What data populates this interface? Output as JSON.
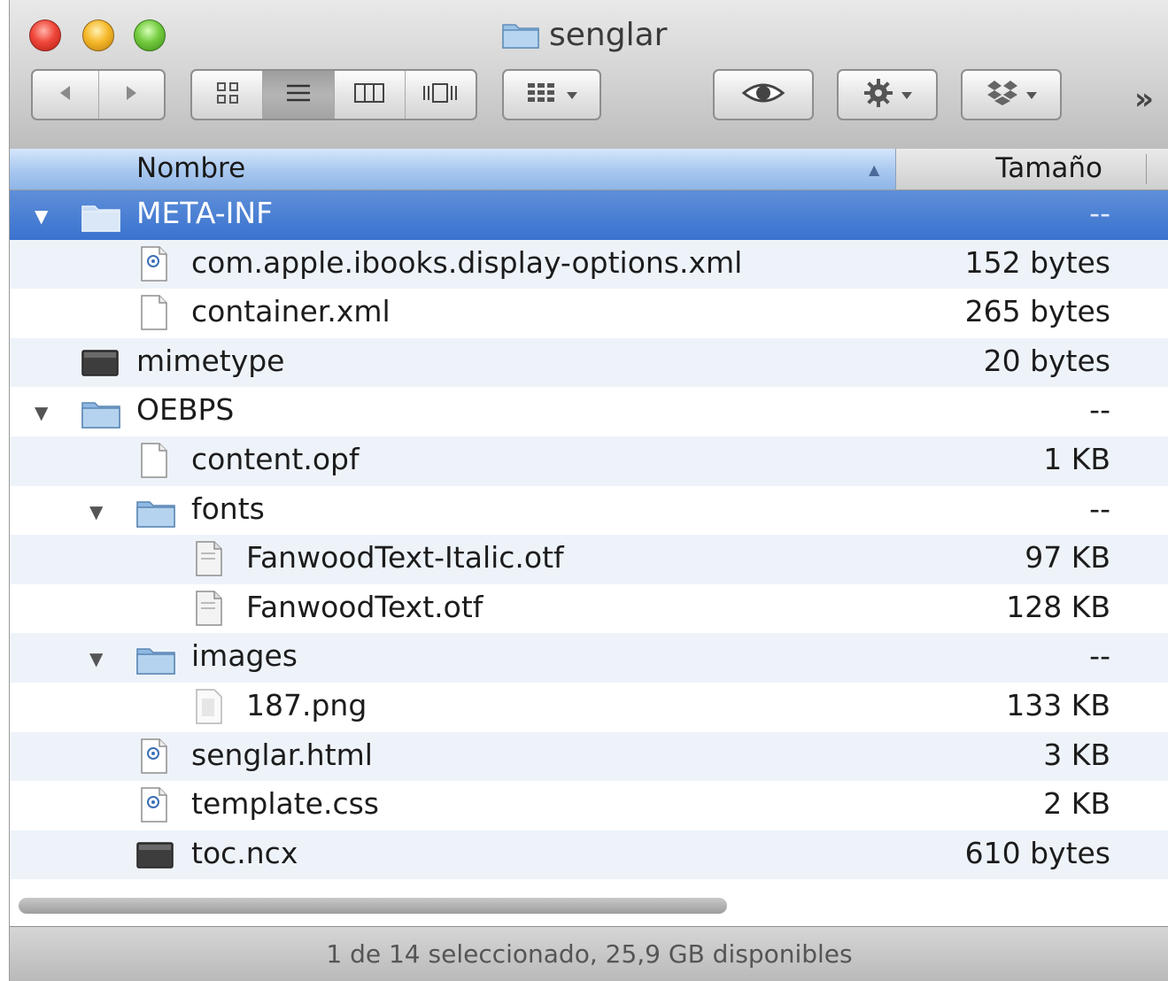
{
  "window": {
    "title": "senglar"
  },
  "toolbar": {
    "back_icon": "back-arrow-icon",
    "forward_icon": "forward-arrow-icon",
    "view_modes": [
      "icon-view-icon",
      "list-view-icon",
      "column-view-icon",
      "coverflow-view-icon"
    ],
    "active_view": "list",
    "arrange_icon": "arrange-icon",
    "quicklook_icon": "eye-icon",
    "action_icon": "gear-icon",
    "share_icon": "dropbox-icon",
    "overflow_label": "»"
  },
  "columns": {
    "name": "Nombre",
    "size": "Tamaño"
  },
  "rows": [
    {
      "name": "META-INF",
      "size": "--",
      "kind": "folder",
      "depth": 0,
      "expanded": true,
      "selected": true
    },
    {
      "name": "com.apple.ibooks.display-options.xml",
      "size": "152 bytes",
      "kind": "xml",
      "depth": 1
    },
    {
      "name": "container.xml",
      "size": "265 bytes",
      "kind": "doc",
      "depth": 1
    },
    {
      "name": "mimetype",
      "size": "20 bytes",
      "kind": "exec",
      "depth": 0
    },
    {
      "name": "OEBPS",
      "size": "--",
      "kind": "folder",
      "depth": 0,
      "expanded": true
    },
    {
      "name": "content.opf",
      "size": "1 KB",
      "kind": "doc",
      "depth": 1
    },
    {
      "name": "fonts",
      "size": "--",
      "kind": "folder",
      "depth": 1,
      "expanded": true
    },
    {
      "name": "FanwoodText-Italic.otf",
      "size": "97 KB",
      "kind": "font",
      "depth": 2
    },
    {
      "name": "FanwoodText.otf",
      "size": "128 KB",
      "kind": "font",
      "depth": 2
    },
    {
      "name": "images",
      "size": "--",
      "kind": "folder",
      "depth": 1,
      "expanded": true
    },
    {
      "name": "187.png",
      "size": "133 KB",
      "kind": "image",
      "depth": 2
    },
    {
      "name": "senglar.html",
      "size": "3 KB",
      "kind": "xml",
      "depth": 1
    },
    {
      "name": "template.css",
      "size": "2 KB",
      "kind": "xml",
      "depth": 1
    },
    {
      "name": "toc.ncx",
      "size": "610 bytes",
      "kind": "exec",
      "depth": 1
    }
  ],
  "status": {
    "text": "1 de 14 seleccionado, 25,9 GB disponibles"
  }
}
